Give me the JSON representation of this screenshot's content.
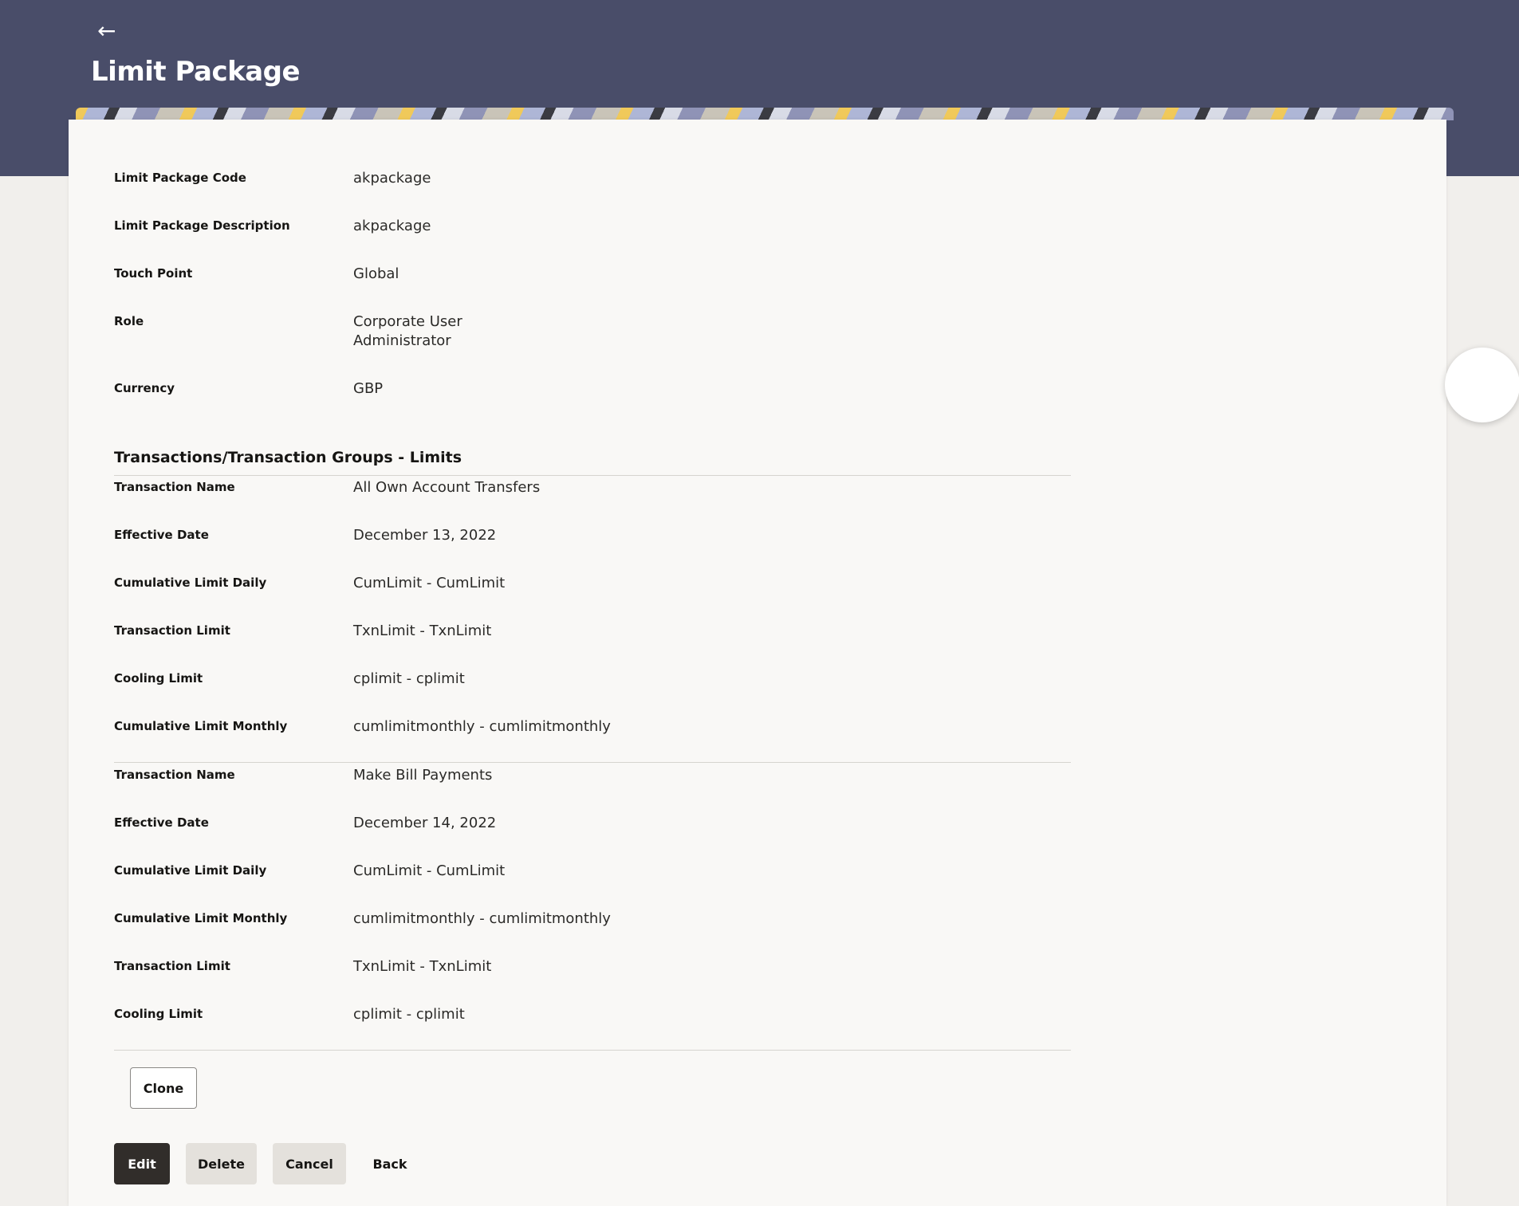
{
  "header": {
    "back_icon": "←",
    "title": "Limit Package"
  },
  "details": [
    {
      "label": "Limit Package Code",
      "value": "akpackage"
    },
    {
      "label": "Limit Package Description",
      "value": "akpackage"
    },
    {
      "label": "Touch Point",
      "value": "Global"
    },
    {
      "label": "Role",
      "value": "Corporate User Administrator"
    },
    {
      "label": "Currency",
      "value": "GBP"
    }
  ],
  "section": {
    "title": "Transactions/Transaction Groups - Limits"
  },
  "transactions": [
    {
      "rows": [
        {
          "label": "Transaction Name",
          "value": "All Own Account Transfers"
        },
        {
          "label": "Effective Date",
          "value": "December 13, 2022"
        },
        {
          "label": "Cumulative Limit Daily",
          "value": "CumLimit - CumLimit"
        },
        {
          "label": "Transaction Limit",
          "value": "TxnLimit - TxnLimit"
        },
        {
          "label": "Cooling Limit",
          "value": "cplimit - cplimit"
        },
        {
          "label": "Cumulative Limit Monthly",
          "value": "cumlimitmonthly - cumlimitmonthly"
        }
      ]
    },
    {
      "rows": [
        {
          "label": "Transaction Name",
          "value": "Make Bill Payments"
        },
        {
          "label": "Effective Date",
          "value": "December 14, 2022"
        },
        {
          "label": "Cumulative Limit Daily",
          "value": "CumLimit - CumLimit"
        },
        {
          "label": "Cumulative Limit Monthly",
          "value": "cumlimitmonthly - cumlimitmonthly"
        },
        {
          "label": "Transaction Limit",
          "value": "TxnLimit - TxnLimit"
        },
        {
          "label": "Cooling Limit",
          "value": "cplimit - cplimit"
        }
      ]
    }
  ],
  "buttons": {
    "clone": "Clone",
    "edit": "Edit",
    "delete": "Delete",
    "cancel": "Cancel",
    "back": "Back"
  },
  "colors": {
    "header_bg": "#494d69",
    "primary_button": "#312d2a",
    "secondary_button": "#e4e1dc"
  }
}
